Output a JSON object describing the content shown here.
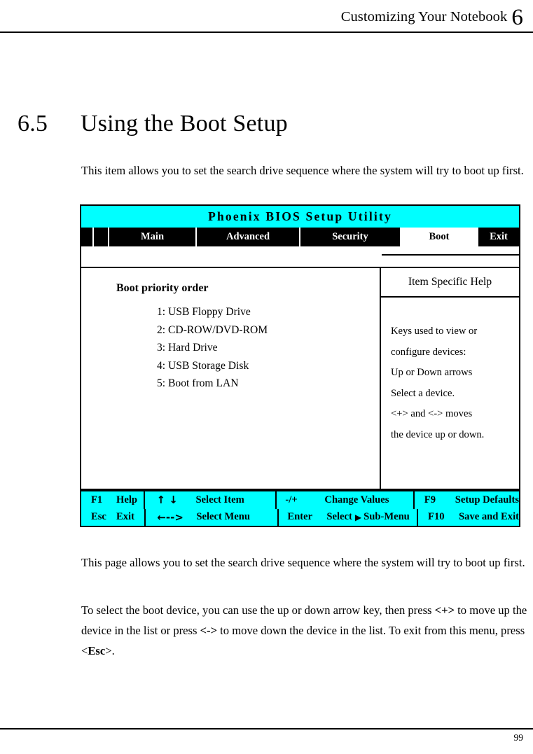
{
  "page": {
    "running_head": "Customizing Your Notebook",
    "chapter_number": "6",
    "page_number": "99"
  },
  "section": {
    "number": "6.5",
    "title": "Using the Boot Setup"
  },
  "paragraphs": {
    "intro": "This item allows you to set the search drive sequence where the system will try to boot up first.",
    "outro_1": "This page allows you to set the search drive sequence where the system will try to boot up first.",
    "outro_2_part1": "To select the boot device, you can use the up or down arrow key, then press ",
    "outro_2_key_plus": "<+>",
    "outro_2_part2": " to move up the device in the list or press ",
    "outro_2_key_minus": "<->",
    "outro_2_part3": " to move down the device in the list. To exit from this menu, press <",
    "outro_2_key_esc": "Esc",
    "outro_2_part4": ">."
  },
  "bios": {
    "title": "Phoenix BIOS Setup Utility",
    "colors": {
      "accent": "#00FFFF",
      "text": "#000000",
      "background": "#FFFFFF"
    },
    "tabs": [
      {
        "label": "",
        "selected": false
      },
      {
        "label": "",
        "selected": false
      },
      {
        "label": "Main",
        "selected": false
      },
      {
        "label": "Advanced",
        "selected": false
      },
      {
        "label": "Security",
        "selected": false
      },
      {
        "label": "Boot",
        "selected": true
      },
      {
        "label": "Exit",
        "selected": false
      }
    ],
    "main_panel": {
      "heading": "Boot priority order",
      "items": [
        "1: USB Floppy Drive",
        "2: CD-ROW/DVD-ROM",
        "3: Hard Drive",
        "4: USB Storage Disk",
        "5: Boot from LAN"
      ]
    },
    "help_panel": {
      "heading": "Item Specific Help",
      "lines": [
        "Keys used to view or",
        "configure devices:",
        "Up or Down arrows",
        "Select a device.",
        "<+> and <-> moves",
        "the device up or down."
      ]
    },
    "footer_keys": [
      {
        "key": "F1",
        "action": "Help"
      },
      {
        "key": "↑ ↓",
        "action": "Select Item"
      },
      {
        "key": "-/+",
        "action": "Change Values"
      },
      {
        "key": "F9",
        "action": "Setup Defaults"
      },
      {
        "key": "Esc",
        "action": "Exit"
      },
      {
        "key": "←-->",
        "action": "Select Menu"
      },
      {
        "key": "Enter",
        "action_before": "Select",
        "action_after": "Sub-Menu"
      },
      {
        "key": "F10",
        "action": "Save and Exit"
      }
    ]
  }
}
